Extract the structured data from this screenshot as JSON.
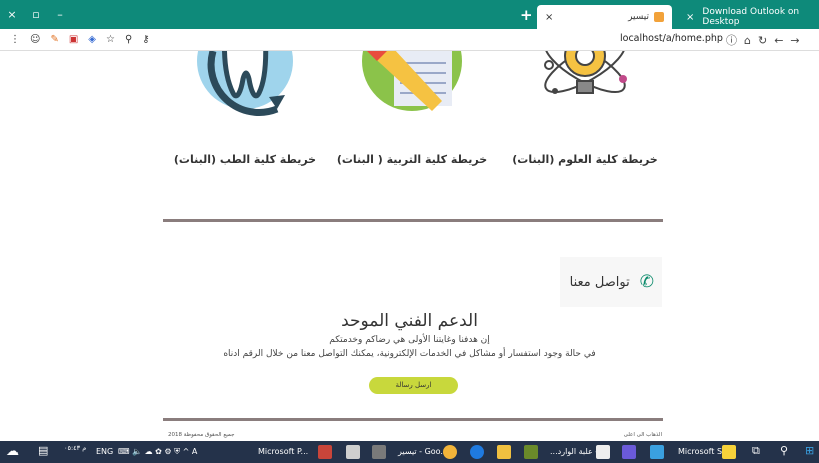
{
  "browser": {
    "tabs": [
      {
        "label": "تيسير",
        "close": "×"
      },
      {
        "label": "Download Outlook on Desktop",
        "close": "×"
      }
    ],
    "window_controls": [
      "×",
      "▫",
      "–"
    ],
    "new_tab": "+",
    "url": "localhost/a/home.php"
  },
  "cards": [
    {
      "title": "خريطة كلية الطب (البنات)"
    },
    {
      "title": "خريطة كلية التربية ( البنات)"
    },
    {
      "title": "خريطة كلية العلوم (البنات)"
    }
  ],
  "contact": {
    "title": "تواصل معنا",
    "phone_icon": "phone-icon"
  },
  "support": {
    "title": "الدعم الفني الموحد",
    "line1": "إن هدفنا وغايتنا الأولى هي رضاكم وخدمتكم",
    "line2": "في حالة وجود استفسار أو مشاكل في الخدمات الإلكترونية، يمكنك التواصل معنا من خلال الرقم ادناه",
    "button": "ارسل رسالة"
  },
  "footer": {
    "left": "جميع الحقوق محفوظة 2018",
    "right": "الذهاب الى اعلى"
  },
  "taskbar": {
    "lang": "ENG",
    "items": [
      "Microsoft P...",
      "تيسير - Goo...",
      "...علبة الوارد -",
      "Microsoft St..."
    ],
    "clock": "م ٠٥:٤٣"
  }
}
